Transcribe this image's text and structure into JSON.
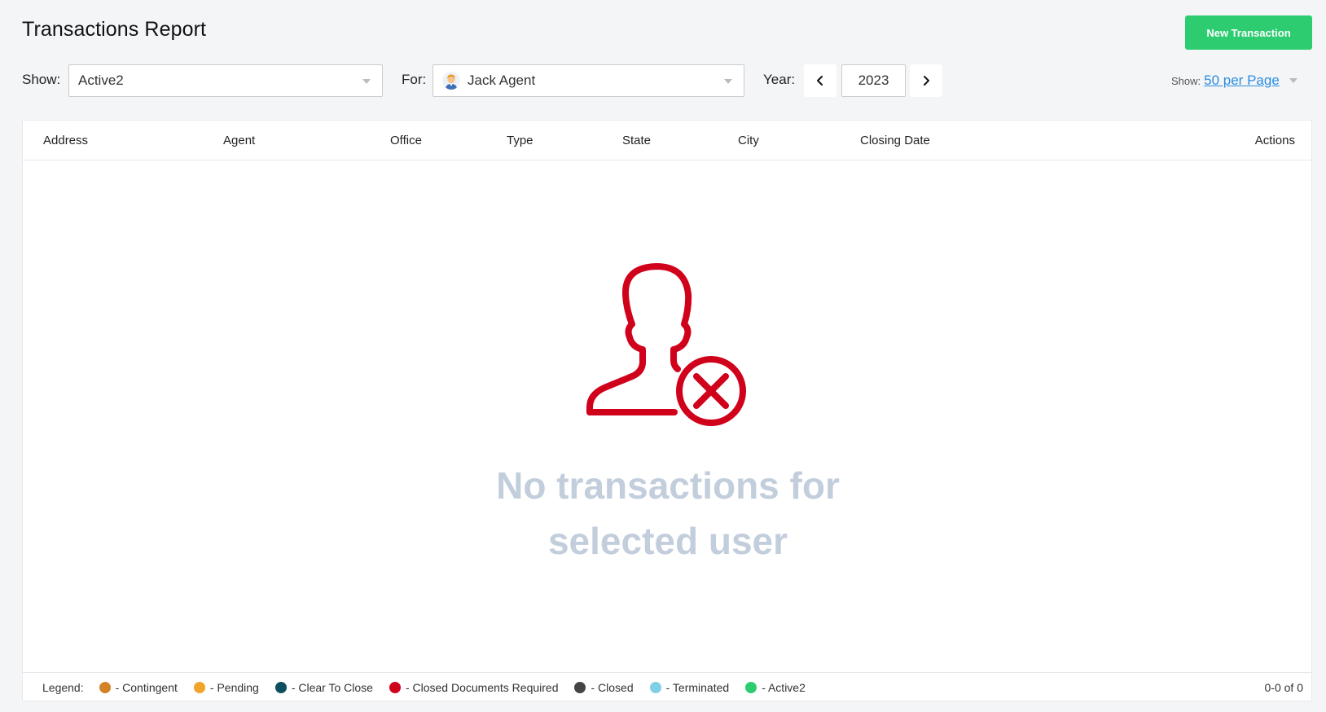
{
  "header": {
    "title": "Transactions Report",
    "new_button": "New Transaction"
  },
  "filters": {
    "show_label": "Show:",
    "show_value": "Active2",
    "for_label": "For:",
    "for_value": "Jack Agent",
    "year_label": "Year:",
    "year_value": "2023",
    "per_page_label": "Show:",
    "per_page_value": "50 per Page"
  },
  "table": {
    "columns": [
      "Address",
      "Agent",
      "Office",
      "Type",
      "State",
      "City",
      "Closing Date",
      "Actions"
    ]
  },
  "empty_state": {
    "message_line1": "No transactions for",
    "message_line2": "selected user",
    "icon": "user-remove-icon",
    "icon_color": "#d0021b"
  },
  "legend": {
    "label": "Legend:",
    "items": [
      {
        "label": "- Contingent",
        "color": "#d4822a"
      },
      {
        "label": "- Pending",
        "color": "#f0a42a"
      },
      {
        "label": "- Clear To Close",
        "color": "#0d4f5e"
      },
      {
        "label": "- Closed Documents Required",
        "color": "#d0021b"
      },
      {
        "label": "- Closed",
        "color": "#444444"
      },
      {
        "label": "- Terminated",
        "color": "#7fd0e6"
      },
      {
        "label": "- Active2",
        "color": "#2ecc71"
      }
    ]
  },
  "pagination": {
    "summary": "0-0 of 0"
  },
  "colors": {
    "accent_green": "#2ecc71",
    "link_blue": "#2b8ee0",
    "empty_text": "#c3cedd"
  }
}
